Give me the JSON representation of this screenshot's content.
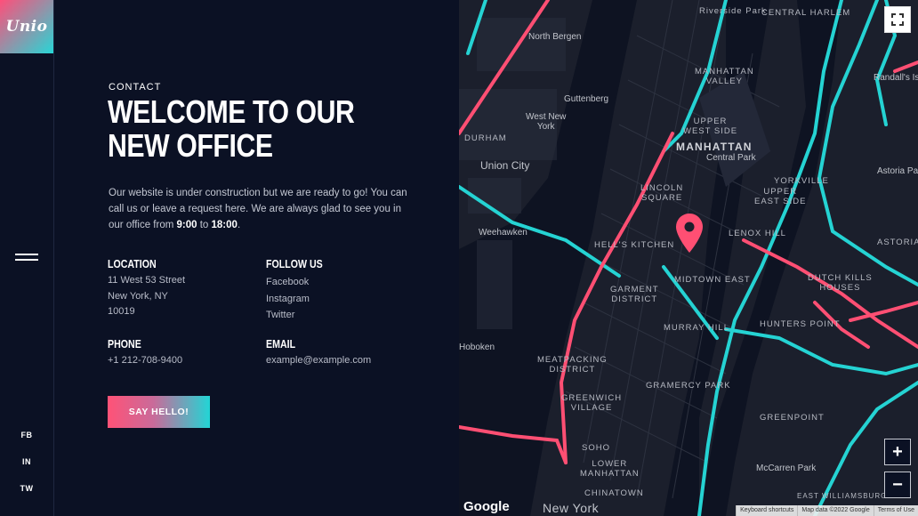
{
  "brand": {
    "logo_text": "Unio"
  },
  "sidebar": {
    "menu_icon": "hamburger-icon",
    "social": [
      "FB",
      "IN",
      "TW"
    ]
  },
  "contact": {
    "eyebrow": "CONTACT",
    "title": "WELCOME TO OUR NEW OFFICE",
    "description_1": "Our website is under construction but we are ready to go! You can call us or leave a request here. We are always glad to see you in our office from ",
    "hours_from": "9:00",
    "description_to": " to ",
    "hours_to": "18:00",
    "description_end": "."
  },
  "location": {
    "heading": "LOCATION",
    "line1": "11 West 53 Street",
    "line2": "New York, NY",
    "line3": "10019"
  },
  "follow": {
    "heading": "FOLLOW US",
    "links": [
      "Facebook",
      "Instagram",
      "Twitter"
    ]
  },
  "phone": {
    "heading": "PHONE",
    "value": "+1 212-708-9400"
  },
  "email": {
    "heading": "EMAIL",
    "value": "example@example.com"
  },
  "cta": {
    "label": "SAY HELLO!"
  },
  "map": {
    "labels": {
      "riverside": "Riverside Park",
      "central_harlem": "CENTRAL HARLEM",
      "north_bergen": "North Bergen",
      "manhattan_valley": "MANHATTAN\nVALLEY",
      "randalls": "Randall's Island",
      "guttenberg": "Guttenberg",
      "west_new_york": "West New\nYork",
      "upper_west_side": "UPPER\nWEST SIDE",
      "durham": "DURHAM",
      "manhattan": "MANHATTAN",
      "central_park": "Central Park",
      "union_city": "Union City",
      "yorkville": "YORKVILLE",
      "astoria_park": "Astoria Park",
      "lincoln_square": "LINCOLN\nSQUARE",
      "upper_east_side": "UPPER\nEAST SIDE",
      "weehawken": "Weehawken",
      "hells_kitchen": "HELL'S KITCHEN",
      "lenox_hill": "LENOX HILL",
      "astoria": "ASTORIA",
      "garment_district": "GARMENT\nDISTRICT",
      "midtown_east": "MIDTOWN EAST",
      "dutch_kills": "DUTCH KILLS\nHOUSES",
      "murray_hill": "MURRAY HILL",
      "hunters_point": "HUNTERS POINT",
      "hoboken": "Hoboken",
      "meatpacking": "MEATPACKING\nDISTRICT",
      "gramercy": "GRAMERCY PARK",
      "greenwich": "GREENWICH\nVILLAGE",
      "greenpoint": "GREENPOINT",
      "soho": "SOHO",
      "lower_manhattan": "LOWER\nMANHATTAN",
      "mccarren": "McCarren Park",
      "chinatown": "CHINATOWN",
      "new_york": "New York",
      "east_williamsburg": "EAST WILLIAMSBURG"
    },
    "zoom_in": "+",
    "zoom_out": "−",
    "google_logo": "Google",
    "footer": [
      "Keyboard shortcuts",
      "Map data ©2022 Google",
      "Terms of Use"
    ],
    "marker_icon": "map-pin-icon",
    "fullscreen_icon": "fullscreen-icon"
  },
  "colors": {
    "accent_pink": "#ff4f7a",
    "accent_cyan": "#27d6d6",
    "background": "#0b1124"
  }
}
